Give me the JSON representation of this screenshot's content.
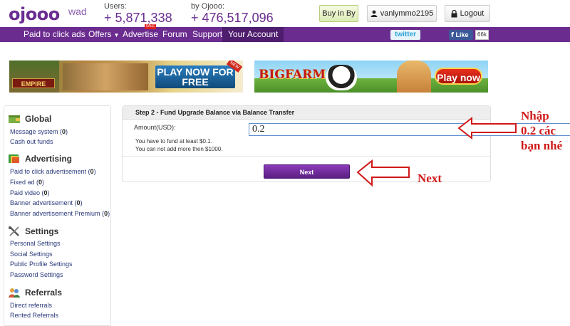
{
  "header": {
    "logo": "ojooo",
    "logo_sub": "wad",
    "users_label": "Users:",
    "users_value": "+ 5,871,338",
    "ojooo_label": "by Ojooo:",
    "ojooo_value": "+ 476,517,096",
    "buy_label": "Buy in By",
    "username": "vanlymmo2195",
    "logout_label": "Logout"
  },
  "nav": {
    "items": [
      "Paid to click ads",
      "Offers",
      "Advertise",
      "Forum",
      "Support",
      "Your Account"
    ],
    "hot_badge": "SALE",
    "twitter": "twitter",
    "fb_like": "Like",
    "fb_count": "66k"
  },
  "banners": {
    "b1_title": "EMPIRE",
    "b1_cta": "PLAY NOW FOR FREE",
    "b1_corner": "NEW",
    "b2_title": "BIGFARM",
    "b2_cta": "Play now"
  },
  "sidebar": {
    "global_title": "Global",
    "global_items": [
      {
        "label": "Message system (",
        "count": "0",
        "end": ")"
      },
      {
        "label": "Cash out funds",
        "count": "",
        "end": ""
      }
    ],
    "adv_title": "Advertising",
    "adv_items": [
      {
        "label": "Paid to click advertisement (",
        "count": "0",
        "end": ")"
      },
      {
        "label": "Fixed ad (",
        "count": "0",
        "end": ")"
      },
      {
        "label": "Paid video (",
        "count": "0",
        "end": ")"
      },
      {
        "label": "Banner advertisement (",
        "count": "0",
        "end": ")"
      },
      {
        "label": "Banner advertisement Premium (",
        "count": "0",
        "end": ")"
      }
    ],
    "settings_title": "Settings",
    "settings_items": [
      "Personal Settings",
      "Social Settings",
      "Public Profile Settings",
      "Password Settings"
    ],
    "ref_title": "Referrals",
    "ref_items": [
      "Direct referrals",
      "Rented Referrals"
    ]
  },
  "panel": {
    "title": "Step 2 - Fund Upgrade Balance via Balance Transfer",
    "amount_label": "Amount(USD):",
    "amount_value": "0.2",
    "note1": "You have to fund at least $0.1.",
    "note2": "You can not add more then $1000.",
    "next_label": "Next"
  },
  "annotations": {
    "line1": "Nhập",
    "line2": "0.2 các",
    "line3": "bạn nhé",
    "next": "Next",
    "color": "#d01818"
  }
}
